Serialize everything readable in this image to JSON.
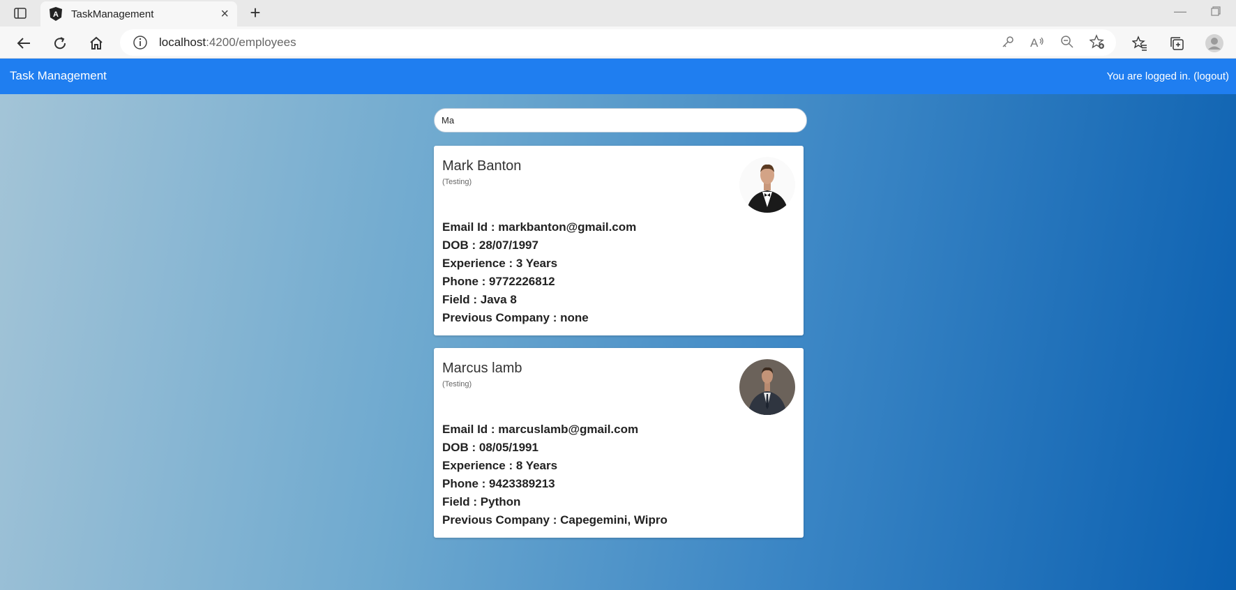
{
  "browser": {
    "tab_title": "TaskManagement",
    "url_host": "localhost",
    "url_rest": ":4200/employees"
  },
  "app": {
    "brand": "Task Management",
    "login_text": "You are logged in.",
    "logout_label": "(logout)",
    "accent": "#1f7ef0"
  },
  "search": {
    "value": "Ma"
  },
  "employees": [
    {
      "name": "Mark Banton",
      "dept": "(Testing)",
      "email": "Email Id : markbanton@gmail.com",
      "dob": "DOB : 28/07/1997",
      "experience": "Experience : 3 Years",
      "phone": "Phone : 9772226812",
      "field": "Field : Java 8",
      "previous": "Previous Company : none"
    },
    {
      "name": "Marcus lamb",
      "dept": "(Testing)",
      "email": "Email Id : marcuslamb@gmail.com",
      "dob": "DOB : 08/05/1991",
      "experience": "Experience : 8 Years",
      "phone": "Phone : 9423389213",
      "field": "Field : Python",
      "previous": "Previous Company : Capegemini, Wipro"
    }
  ]
}
